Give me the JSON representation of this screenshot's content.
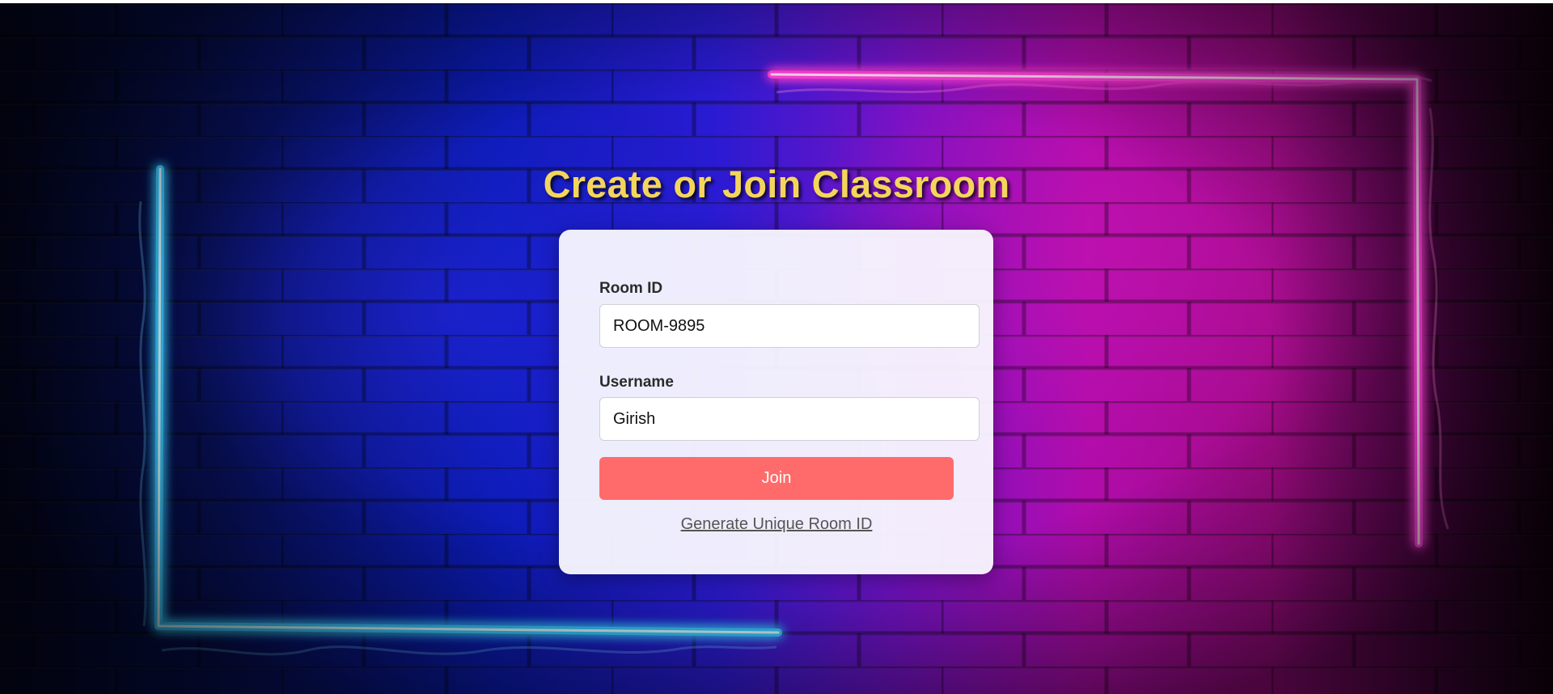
{
  "page": {
    "title": "Create or Join Classroom"
  },
  "form": {
    "room_id_label": "Room ID",
    "room_id_value": "ROOM-9895",
    "username_label": "Username",
    "username_value": "Girish",
    "join_label": "Join",
    "generate_link_label": "Generate Unique Room ID"
  },
  "colors": {
    "title": "#f4d55c",
    "join_button": "#ff6b6b",
    "neon_blue": "#5fe3ff",
    "neon_pink": "#ff3fd8"
  }
}
